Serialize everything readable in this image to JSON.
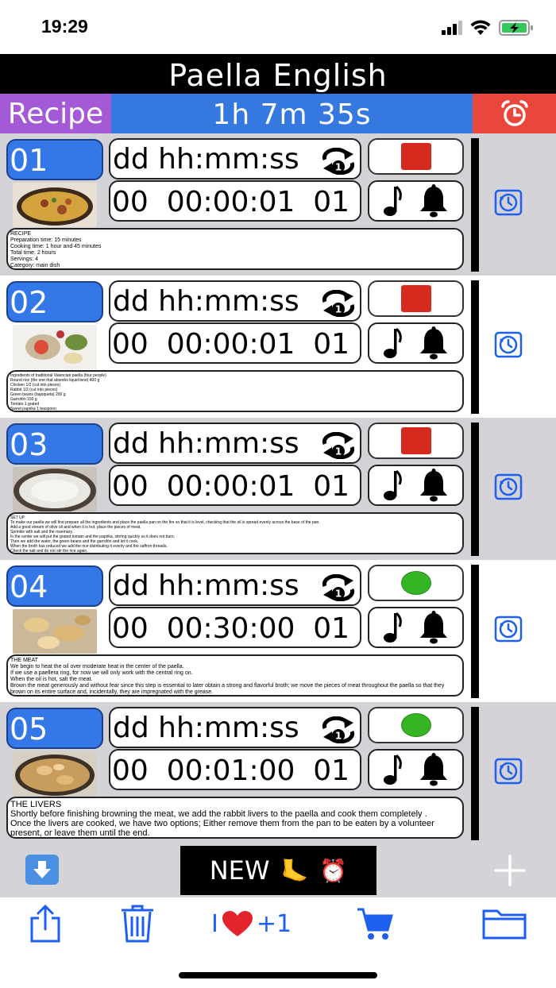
{
  "status_bar": {
    "time": "19:29"
  },
  "app": {
    "title": "Paella English"
  },
  "header": {
    "recipe_tab": "Recipe",
    "total_time": "1h 7m 35s"
  },
  "format_label": "dd hh:mm:ss",
  "steps": [
    {
      "number": "01",
      "value": "00  00:00:01  01",
      "state": "stopped",
      "note": "RECIPE\nPreparation time: 15 minutes\nCooking time: 1 hour and 45 minutes\nTotal time: 2 hours\nServings: 4\nCategory: main dish\nType of cuisine: Valencian\nCalories: 175 kcal per 100 g"
    },
    {
      "number": "02",
      "value": "00  00:00:01  01",
      "state": "stopped",
      "note": "Ingredients of traditional Valencian paella (four people)\nRound rice (the one that absorbs liquid best) 400 g\nChicken 1/2 (cut into pieces)\nRabbit 1/2 (cut into pieces)\nGreen beans (bajoqueta) 200 g\nGarrofón 150 g\nTomato 1 grated\nSweet paprika 1 teaspoon\nSaffron threads\nOlive oil\nSalt\nRosemary\nWater 1.5 l approximately\n\nNotes\nThe quantities are approximate and depend on the size of the paella pan.\nThe paella pan should be about 45-50 cm in diameter for 4 people.\nWe will also need the wood or gas burner where to cook it."
    },
    {
      "number": "03",
      "value": "00  00:00:01  01",
      "state": "stopped",
      "note": "SET UP\nTo make our paella we will first prepare all the ingredients and place the paella pan on the fire so that it is level, checking that the oil is spread evenly across the base of the pan.\nAdd a good stream of olive oil and when it is hot, place the pieces of meat.\nSprinkle with salt and the rosemary.\nIn the center we will put the grated tomato and the paprika, stirring quickly so it does not burn.\nThen we add the water, the green beans and the garrofón and let it cook.\nWhen the broth has reduced we add the rice distributing it evenly and the saffron threads.\nCheck the salt and do not stir the rice again.\nThe heat should be strong at first and then lowered little by little so that the rice is loose and dry at the end.\nLet it rest a few minutes before serving."
    },
    {
      "number": "04",
      "value": "00  00:30:00  01",
      "state": "running",
      "note": "THE MEAT\nWe begin to heat the oil over moderate heat in the center of the paella.\nIf we use a paellera ring, for now we will only work with the central ring on.\nWhen the oil is hot, salt the meat.\nBrown the meat generously and without fear since this step is essential to later obtain a strong and flavorful broth; we move the pieces of meat throughout the paella so that they brown on its entire surface and, incidentally, they are impregnated with the grease.\nIt will then be deposited in the contour of the paella.\nThis step can easily take 30 minutes.\nDon't worry about burning the meat.\nIt's about leaving it with a beautiful and intense golden tone all over its surface."
    },
    {
      "number": "05",
      "value": "00  00:01:00  01",
      "state": "running",
      "note": "THE LIVERS\nShortly before finishing browning the meat, we add the rabbit livers to the paella and cook them completely .\nOnce the livers are cooked, we have two options; Either remove them from the pan to be eaten by a volunteer present, or leave them until the end."
    }
  ],
  "bottom_bar": {
    "new_label": "NEW",
    "new_emoji_1": "🦶",
    "new_emoji_2": "⏰"
  },
  "toolbar": {
    "love_prefix": "I",
    "love_suffix": "+1"
  },
  "colors": {
    "accent_blue": "#3478e8",
    "recipe_purple": "#a45ad6",
    "alarm_red": "#e9463c",
    "stop_red": "#d62a1e",
    "run_green": "#35b524"
  }
}
